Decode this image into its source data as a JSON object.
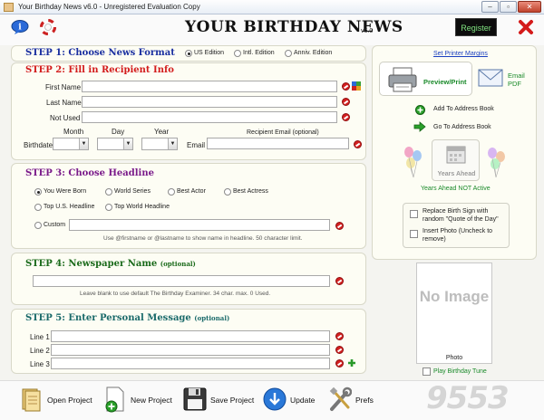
{
  "window": {
    "title": "Your Birthday News v6.0 - Unregistered Evaluation Copy"
  },
  "header": {
    "logo": "YOUR BIRTHDAY NEWS",
    "version": "v6.0",
    "register": "Register"
  },
  "step1": {
    "title": "STEP 1: Choose News Format",
    "options": [
      "US Edition",
      "Intl. Edition",
      "Anniv. Edition"
    ],
    "selected": "US Edition"
  },
  "step2": {
    "title": "STEP 2: Fill in Recipient Info",
    "first_name_label": "First Name",
    "last_name_label": "Last Name",
    "not_used_label": "Not Used",
    "month_label": "Month",
    "day_label": "Day",
    "year_label": "Year",
    "birthdate_label": "Birthdate",
    "email_label": "Email",
    "recipient_email_label": "Recipient Email (optional)"
  },
  "step3": {
    "title": "STEP 3: Choose Headline",
    "options": [
      "You Were Born",
      "World Series",
      "Best Actor",
      "Best Actress",
      "Top U.S. Headline",
      "Top World Headline",
      "Custom"
    ],
    "selected": "You Were Born",
    "hint": "Use @firstname or @lastname to show name in headline. 50 character limit."
  },
  "step4": {
    "title": "STEP 4: Newspaper Name",
    "optional": "(optional)",
    "hint": "Leave blank to use default The Birthday Examiner. 34 char. max. 0 Used."
  },
  "step5": {
    "title": "STEP 5: Enter Personal Message",
    "optional": "(optional)",
    "lines": [
      "Line 1",
      "Line 2",
      "Line 3"
    ]
  },
  "right": {
    "printer_margins": "Set Printer Margins",
    "preview_print": "Preview/Print",
    "email_pdf": "Email PDF",
    "add_address": "Add To Address Book",
    "goto_address": "Go To Address Book",
    "years_ahead": "Years Ahead",
    "years_ahead_status": "Years Ahead NOT Active",
    "replace_sign": "Replace Birth Sign with random \"Quote of the Day\"",
    "insert_photo": "Insert Photo (Uncheck to remove)",
    "no_image": "No Image",
    "photo_label": "Photo",
    "play_tune": "Play Birthday Tune"
  },
  "toolbar": {
    "open": "Open Project",
    "new": "New Project",
    "save": "Save Project",
    "update": "Update",
    "prefs": "Prefs"
  },
  "watermark": "9553",
  "colors": {
    "step_blue": "#1a2fa0",
    "step_red": "#d31c1c",
    "step_purple": "#7a1a8a",
    "step_green": "#1a6a1a",
    "step_teal": "#1a6a6a",
    "link_green": "#1a8a2a"
  }
}
